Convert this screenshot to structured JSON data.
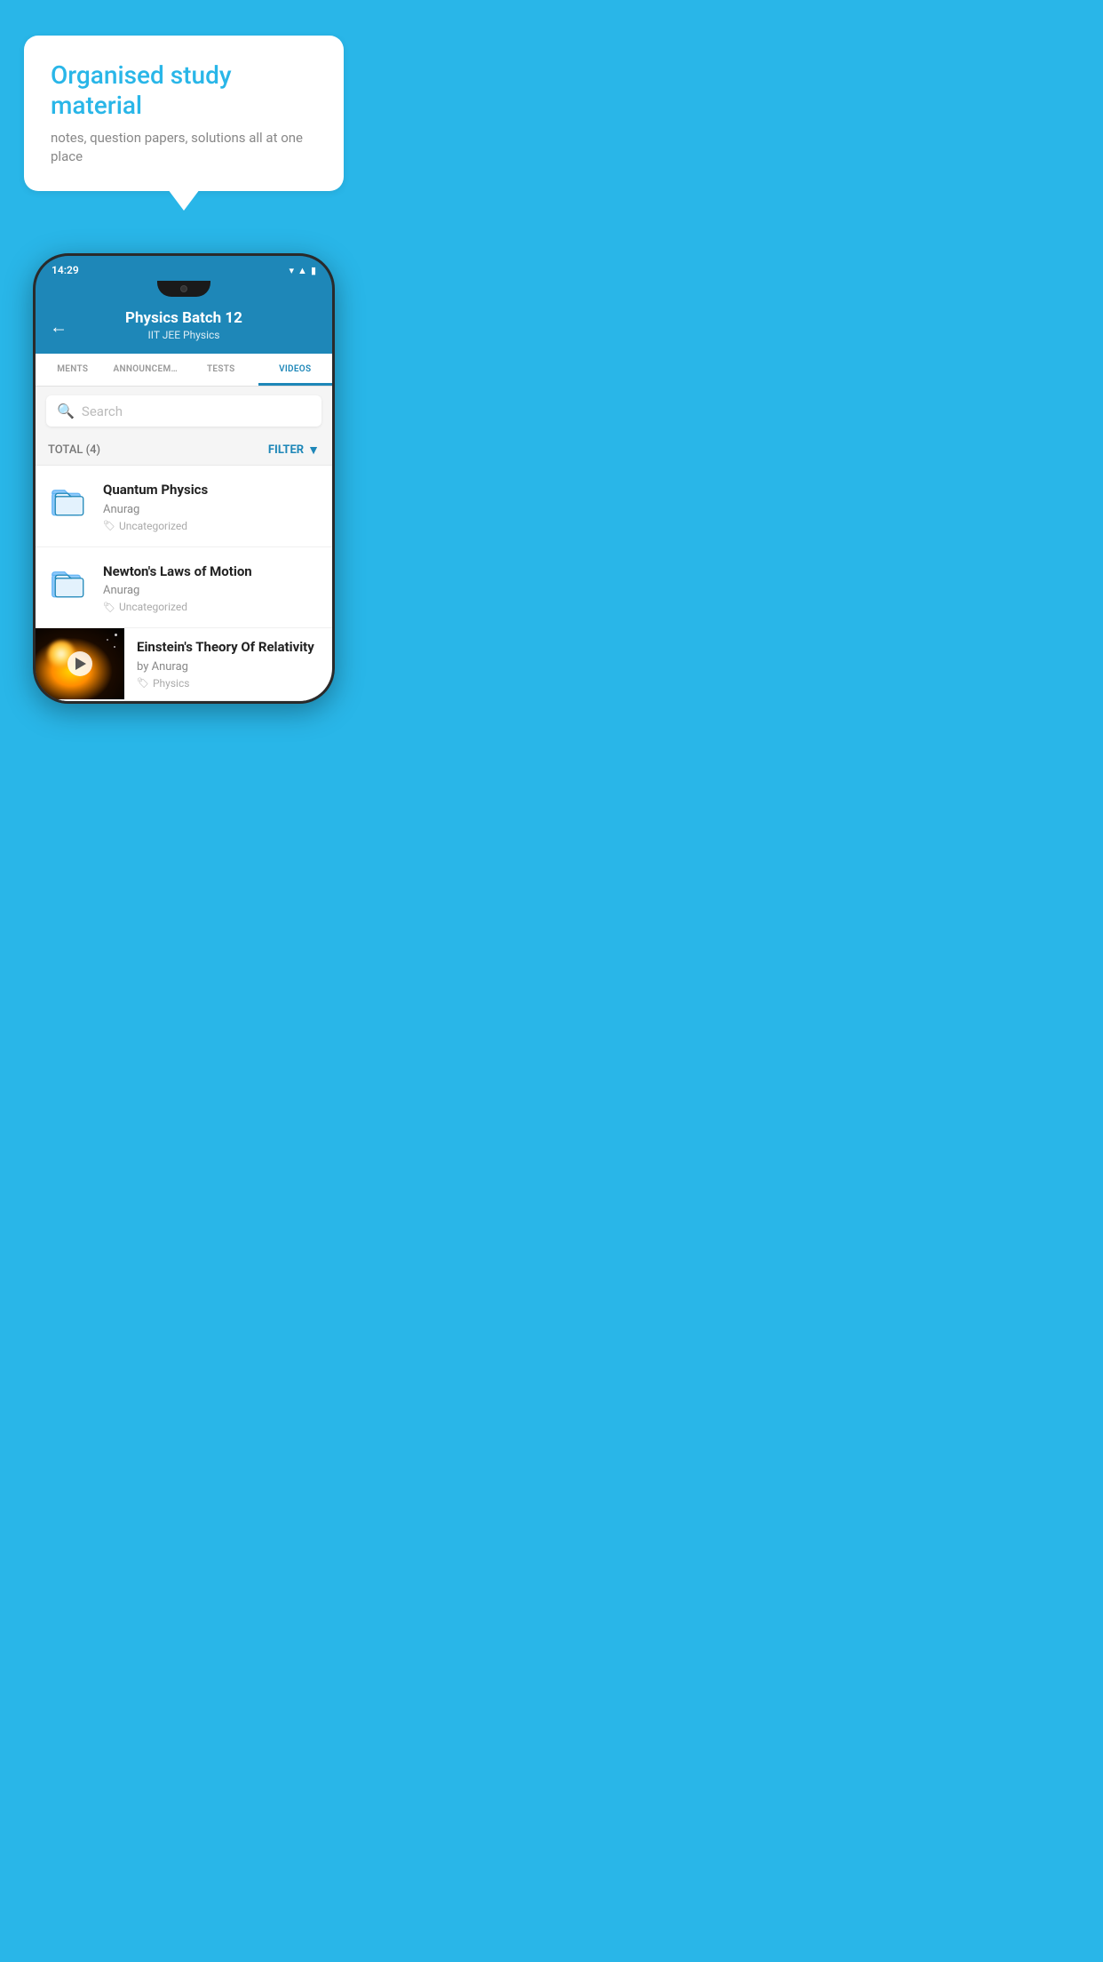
{
  "background_color": "#29b6e8",
  "promo": {
    "title": "Organised study material",
    "subtitle": "notes, question papers, solutions all at one place"
  },
  "phone": {
    "status_bar": {
      "time": "14:29",
      "icons": [
        "wifi",
        "signal",
        "battery"
      ]
    },
    "header": {
      "title": "Physics Batch 12",
      "subtitle": "IIT JEE   Physics",
      "back_label": "←"
    },
    "tabs": [
      {
        "label": "MENTS",
        "active": false
      },
      {
        "label": "ANNOUNCEMENTS",
        "active": false
      },
      {
        "label": "TESTS",
        "active": false
      },
      {
        "label": "VIDEOS",
        "active": true
      }
    ],
    "search": {
      "placeholder": "Search"
    },
    "filter_bar": {
      "total": "TOTAL (4)",
      "filter_label": "FILTER"
    },
    "videos": [
      {
        "id": "quantum",
        "title": "Quantum Physics",
        "author": "Anurag",
        "tag": "Uncategorized",
        "type": "folder"
      },
      {
        "id": "newton",
        "title": "Newton's Laws of Motion",
        "author": "Anurag",
        "tag": "Uncategorized",
        "type": "folder"
      },
      {
        "id": "einstein",
        "title": "Einstein's Theory Of Relativity",
        "author": "by Anurag",
        "tag": "Physics",
        "type": "video"
      }
    ]
  }
}
